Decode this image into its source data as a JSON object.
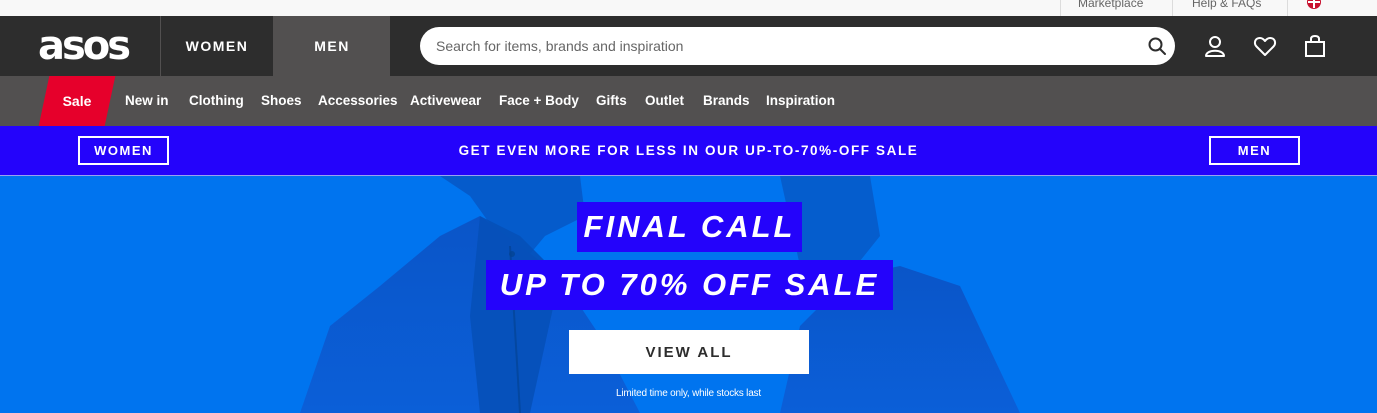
{
  "utility_bar": {
    "links": [
      "Marketplace",
      "Help & FAQs"
    ],
    "flag_icon": "uk-flag-icon"
  },
  "header": {
    "logo": "asos",
    "tabs": [
      {
        "label": "WOMEN",
        "active": false
      },
      {
        "label": "MEN",
        "active": true
      }
    ],
    "search": {
      "placeholder": "Search for items, brands and inspiration",
      "value": "",
      "icon": "search-icon"
    },
    "icons": [
      "account-icon",
      "heart-icon",
      "bag-icon"
    ]
  },
  "category_nav": {
    "sale_label": "Sale",
    "items": [
      "New in",
      "Clothing",
      "Shoes",
      "Accessories",
      "Activewear",
      "Face + Body",
      "Gifts",
      "Outlet",
      "Brands",
      "Inspiration"
    ]
  },
  "promo_strip": {
    "left_button": "WOMEN",
    "text": "GET EVEN MORE FOR LESS IN OUR UP-TO-70%-OFF SALE",
    "right_button": "MEN"
  },
  "hero": {
    "line1": "FINAL CALL",
    "line2": "UP TO 70% OFF SALE",
    "cta": "VIEW ALL",
    "small_print": "Limited time only, while stocks last"
  },
  "colors": {
    "header_bg": "#2d2d2d",
    "nav_bg": "#525050",
    "sale_red": "#e6002b",
    "promo_blue": "#2403fb",
    "hero_blue": "#0074ef"
  }
}
